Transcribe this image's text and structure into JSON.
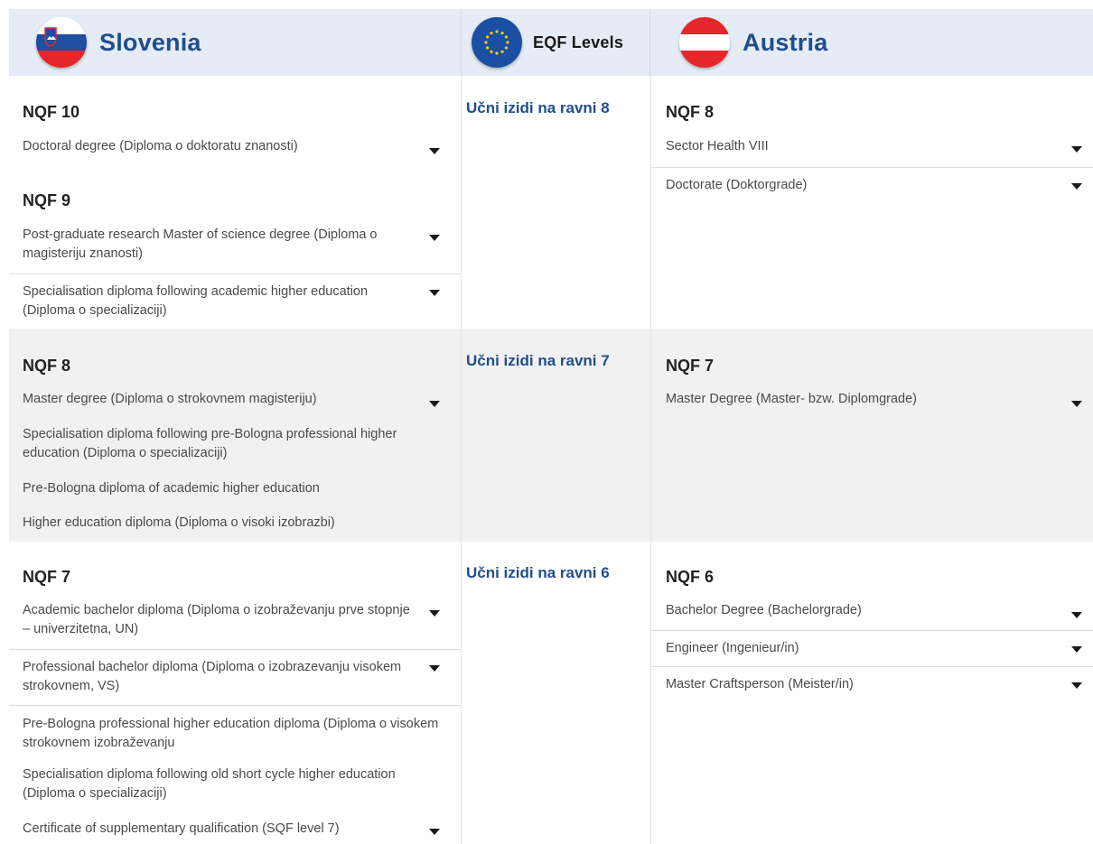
{
  "header": {
    "slovenia": {
      "title": "Slovenia",
      "flag": "slovenia-flag-icon"
    },
    "eqf": {
      "title": "EQF Levels",
      "flag": "eu-flag-icon"
    },
    "austria": {
      "title": "Austria",
      "flag": "austria-flag-icon"
    }
  },
  "levels": [
    {
      "eqf": "Učni izidi na ravni 8",
      "slovenia": [
        {
          "nqf": "NQF 10",
          "items": [
            "Doctoral degree (Diploma o doktoratu znanosti)"
          ]
        },
        {
          "nqf": "NQF 9",
          "items": [
            "Post-graduate research Master of science degree (Diploma o magisteriju znanosti)",
            "Specialisation diploma following academic higher education (Diploma o specializaciji)"
          ]
        }
      ],
      "austria": [
        {
          "nqf": "NQF 8",
          "items": [
            "Sector Health VIII",
            "Doctorate (Doktorgrade)"
          ]
        }
      ]
    },
    {
      "eqf": "Učni izidi na ravni 7",
      "slovenia": [
        {
          "nqf": "NQF 8",
          "items": [
            "Master degree (Diploma o strokovnem magisteriju)",
            "Specialisation diploma following pre-Bologna professional higher education (Diploma o specializaciji)",
            "Pre-Bologna diploma of academic higher education",
            "Higher education diploma (Diploma o visoki izobrazbi)"
          ]
        }
      ],
      "austria": [
        {
          "nqf": "NQF 7",
          "items": [
            "Master Degree (Master- bzw. Diplomgrade)"
          ]
        }
      ]
    },
    {
      "eqf": "Učni izidi na ravni 6",
      "slovenia": [
        {
          "nqf": "NQF 7",
          "items": [
            "Academic bachelor diploma (Diploma o izobraževanju prve stopnje – univerzitetna, UN)",
            "Professional bachelor diploma (Diploma o izobrazevanju visokem strokovnem, VS)",
            "Pre-Bologna professional higher education diploma (Diploma o visokem strokovnem izobraževanju",
            "Specialisation diploma following old short cycle higher education (Diploma o specializaciji)",
            "Certificate of supplementary qualification (SQF level 7)"
          ]
        }
      ],
      "austria": [
        {
          "nqf": "NQF 6",
          "items": [
            "Bachelor Degree (Bachelorgrade)",
            "Engineer (Ingenieur/in)",
            "Master Craftsperson (Meister/in)"
          ]
        }
      ]
    }
  ]
}
